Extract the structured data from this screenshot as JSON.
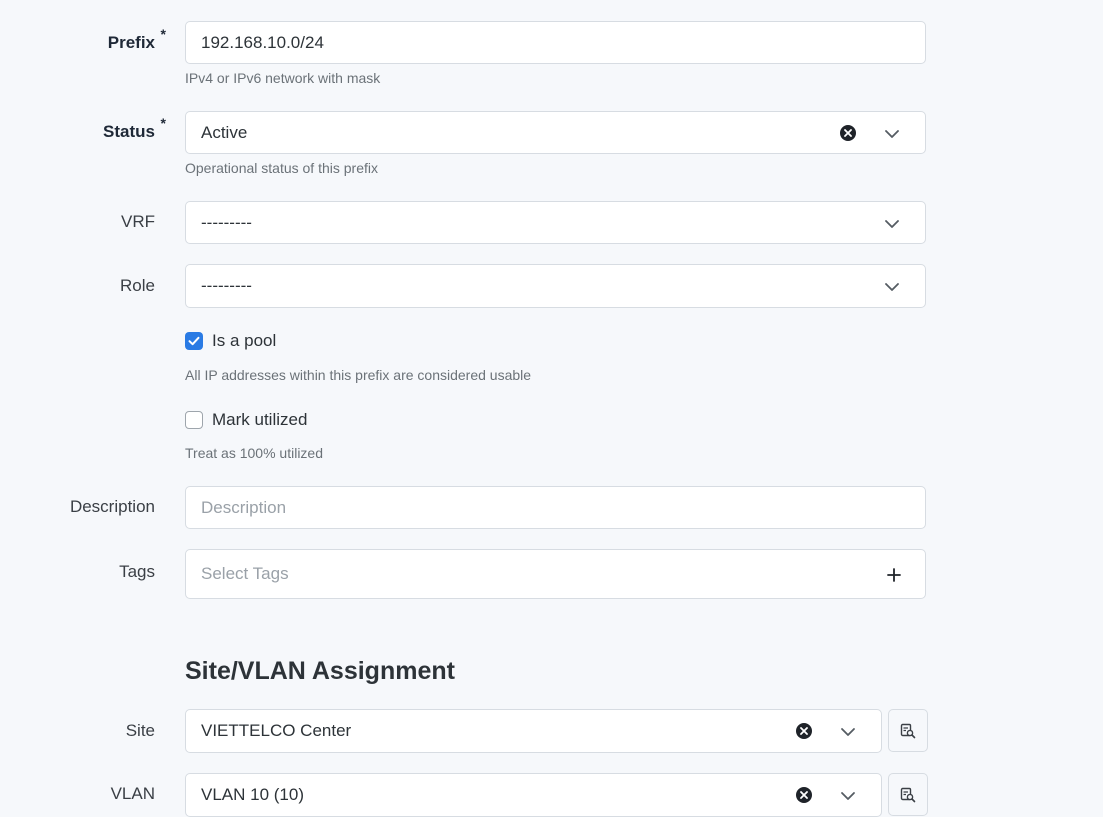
{
  "fields": {
    "prefix": {
      "label": "Prefix",
      "required_mark": "*",
      "value": "192.168.10.0/24",
      "help": "IPv4 or IPv6 network with mask"
    },
    "status": {
      "label": "Status",
      "required_mark": "*",
      "value": "Active",
      "help": "Operational status of this prefix"
    },
    "vrf": {
      "label": "VRF",
      "value": "---------"
    },
    "role": {
      "label": "Role",
      "value": "---------"
    },
    "is_pool": {
      "label": "Is a pool",
      "checked": true,
      "help": "All IP addresses within this prefix are considered usable"
    },
    "mark_utilized": {
      "label": "Mark utilized",
      "checked": false,
      "help": "Treat as 100% utilized"
    },
    "description": {
      "label": "Description",
      "placeholder": "Description"
    },
    "tags": {
      "label": "Tags",
      "placeholder": "Select Tags"
    }
  },
  "section": {
    "title": "Site/VLAN Assignment"
  },
  "assignment": {
    "site": {
      "label": "Site",
      "value": "VIETTELCO Center"
    },
    "vlan": {
      "label": "VLAN",
      "value": "VLAN 10 (10)"
    }
  },
  "colors": {
    "accent": "#2a7be4",
    "background": "#f6f8fb"
  },
  "icons": [
    "clear-icon",
    "chevron-down-icon",
    "plus-icon",
    "lookup-icon",
    "checkmark-icon"
  ]
}
